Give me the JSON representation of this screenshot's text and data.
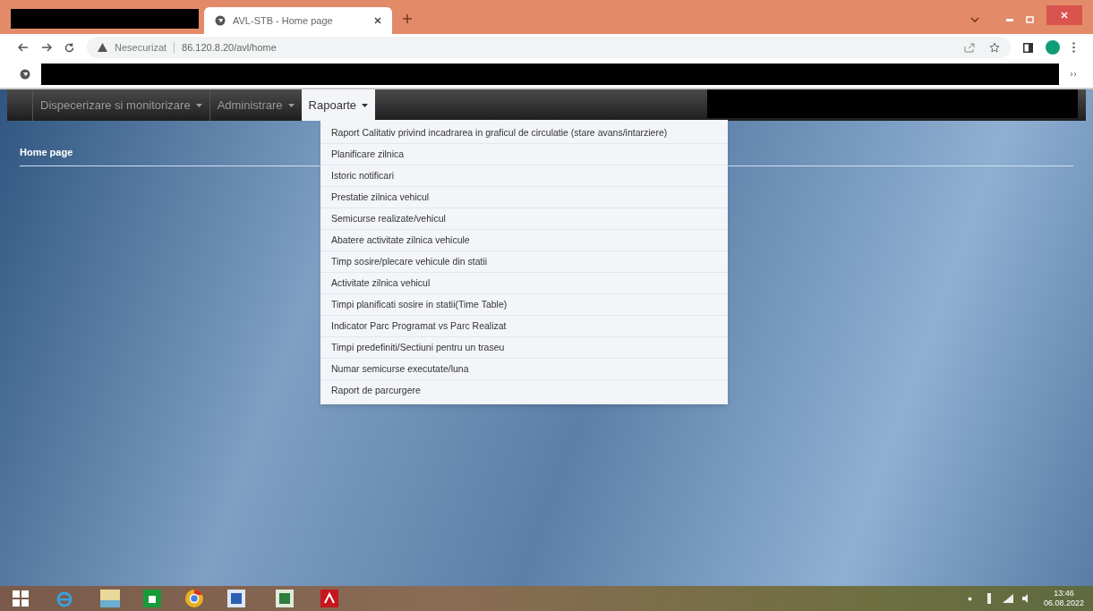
{
  "browser": {
    "tab_title": "AVL-STB - Home page",
    "security_label": "Nesecurizat",
    "url": "86.120.8.20/avl/home"
  },
  "navbar": {
    "items": [
      {
        "label": "Dispecerizare si monitorizare",
        "selected": false
      },
      {
        "label": "Administrare",
        "selected": false
      },
      {
        "label": "Rapoarte",
        "selected": true
      }
    ]
  },
  "dropdown": {
    "items": [
      "Raport Calitativ privind incadrarea in graficul de circulatie (stare avans/intarziere)",
      "Planificare zilnica",
      "Istoric notificari",
      "Prestatie zilnica vehicul",
      "Semicurse realizate/vehicul",
      "Abatere activitate zilnica vehicule",
      "Timp sosire/plecare vehicule din statii",
      "Activitate zilnica vehicul",
      "Timpi planificati sosire in statii(Time Table)",
      "Indicator Parc Programat vs Parc Realizat",
      "Timpi predefiniti/Sectiuni pentru un traseu",
      "Numar semicurse executate/luna",
      "Raport de parcurgere"
    ]
  },
  "page_title": "Home page",
  "taskbar": {
    "time": "13:46",
    "date": "06.08.2022"
  }
}
